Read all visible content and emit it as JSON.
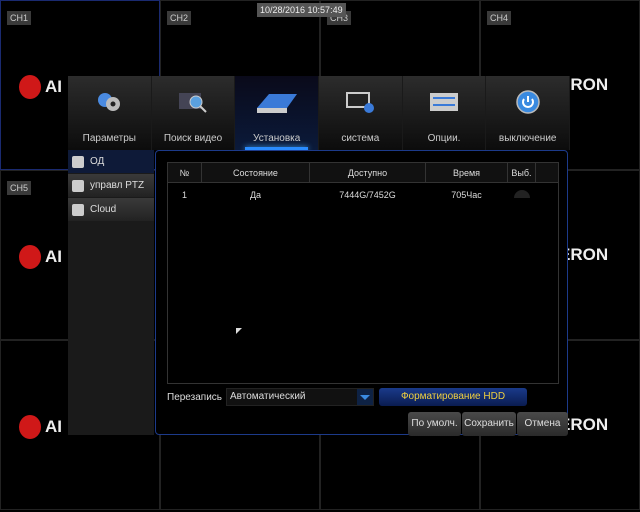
{
  "datetime": "10/28/2016 10:57:49",
  "channels": [
    "CH1",
    "CH2",
    "CH3",
    "CH4",
    "CH5"
  ],
  "logo": {
    "left_text": "AI",
    "right_text": "ERON"
  },
  "menu": [
    {
      "label": "Параметры",
      "icon": "gears-icon"
    },
    {
      "label": "Поиск видео",
      "icon": "video-search-icon"
    },
    {
      "label": "Установка",
      "icon": "hdd-icon",
      "active": true
    },
    {
      "label": "система",
      "icon": "system-info-icon"
    },
    {
      "label": "Опции.",
      "icon": "options-icon"
    },
    {
      "label": "выключение",
      "icon": "power-icon"
    }
  ],
  "sidebar": [
    {
      "label": "ОД",
      "icon": "hdd-icon",
      "active": true
    },
    {
      "label": "управл PTZ",
      "icon": "ptz-camera-icon"
    },
    {
      "label": "Cloud",
      "icon": "cloud-icon"
    }
  ],
  "table": {
    "headers": [
      "№",
      "Состояние",
      "Доступно",
      "Время",
      "Выб."
    ],
    "rows": [
      [
        "1",
        "Да",
        "7444G/7452G",
        "705Час"
      ]
    ]
  },
  "overwrite": {
    "label": "Перезапись",
    "value": "Автоматический"
  },
  "buttons": {
    "format": "Форматирование HDD",
    "default": "По умолч.",
    "save": "Сохранить",
    "cancel": "Отмена"
  },
  "colors": {
    "accent": "#2a8cff",
    "format_text": "#f0d040",
    "logo_red": "#d01818"
  }
}
